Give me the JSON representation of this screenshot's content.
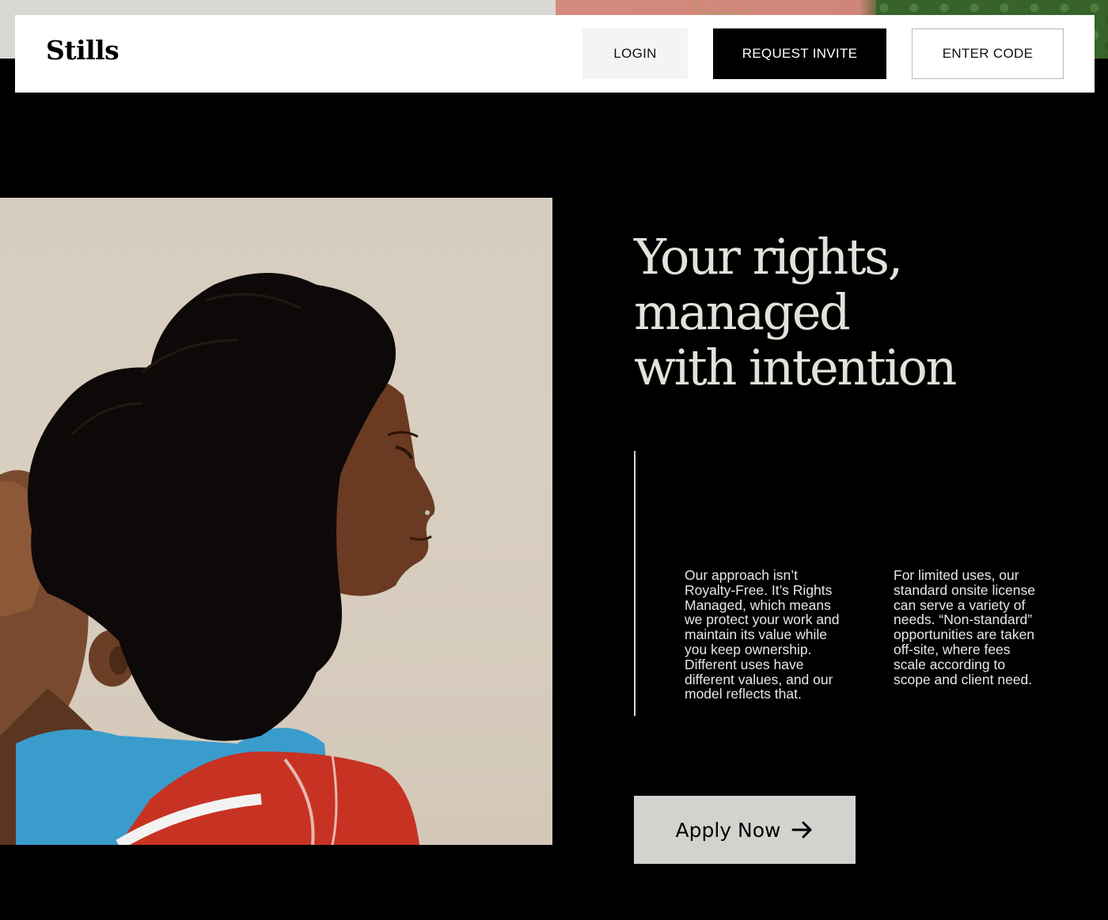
{
  "brand": {
    "logo_text": "Stills"
  },
  "header": {
    "login_label": "LOGIN",
    "request_invite_label": "REQUEST INVITE",
    "enter_code_label": "ENTER CODE"
  },
  "hero": {
    "headline_lines": [
      "Your rights,",
      "managed",
      "with intention"
    ],
    "paragraph_1": "Our approach isn’t Royalty-Free. It’s Rights Managed, which means we protect your work and maintain its value while you keep ownership. Different uses have different values, and our model reflects that.",
    "paragraph_2": "For limited uses, our standard onsite license can serve a variety of needs. “Non-standard” opportunities are taken off-site, where fees scale according to scope and client need.",
    "cta_label": "Apply Now",
    "cta_icon": "arrow-right-icon"
  },
  "colors": {
    "background": "#000000",
    "header_bg": "#ffffff",
    "headline": "#e4e1da",
    "cta_bg": "#d3d2cf",
    "invite_bg": "#000000"
  }
}
